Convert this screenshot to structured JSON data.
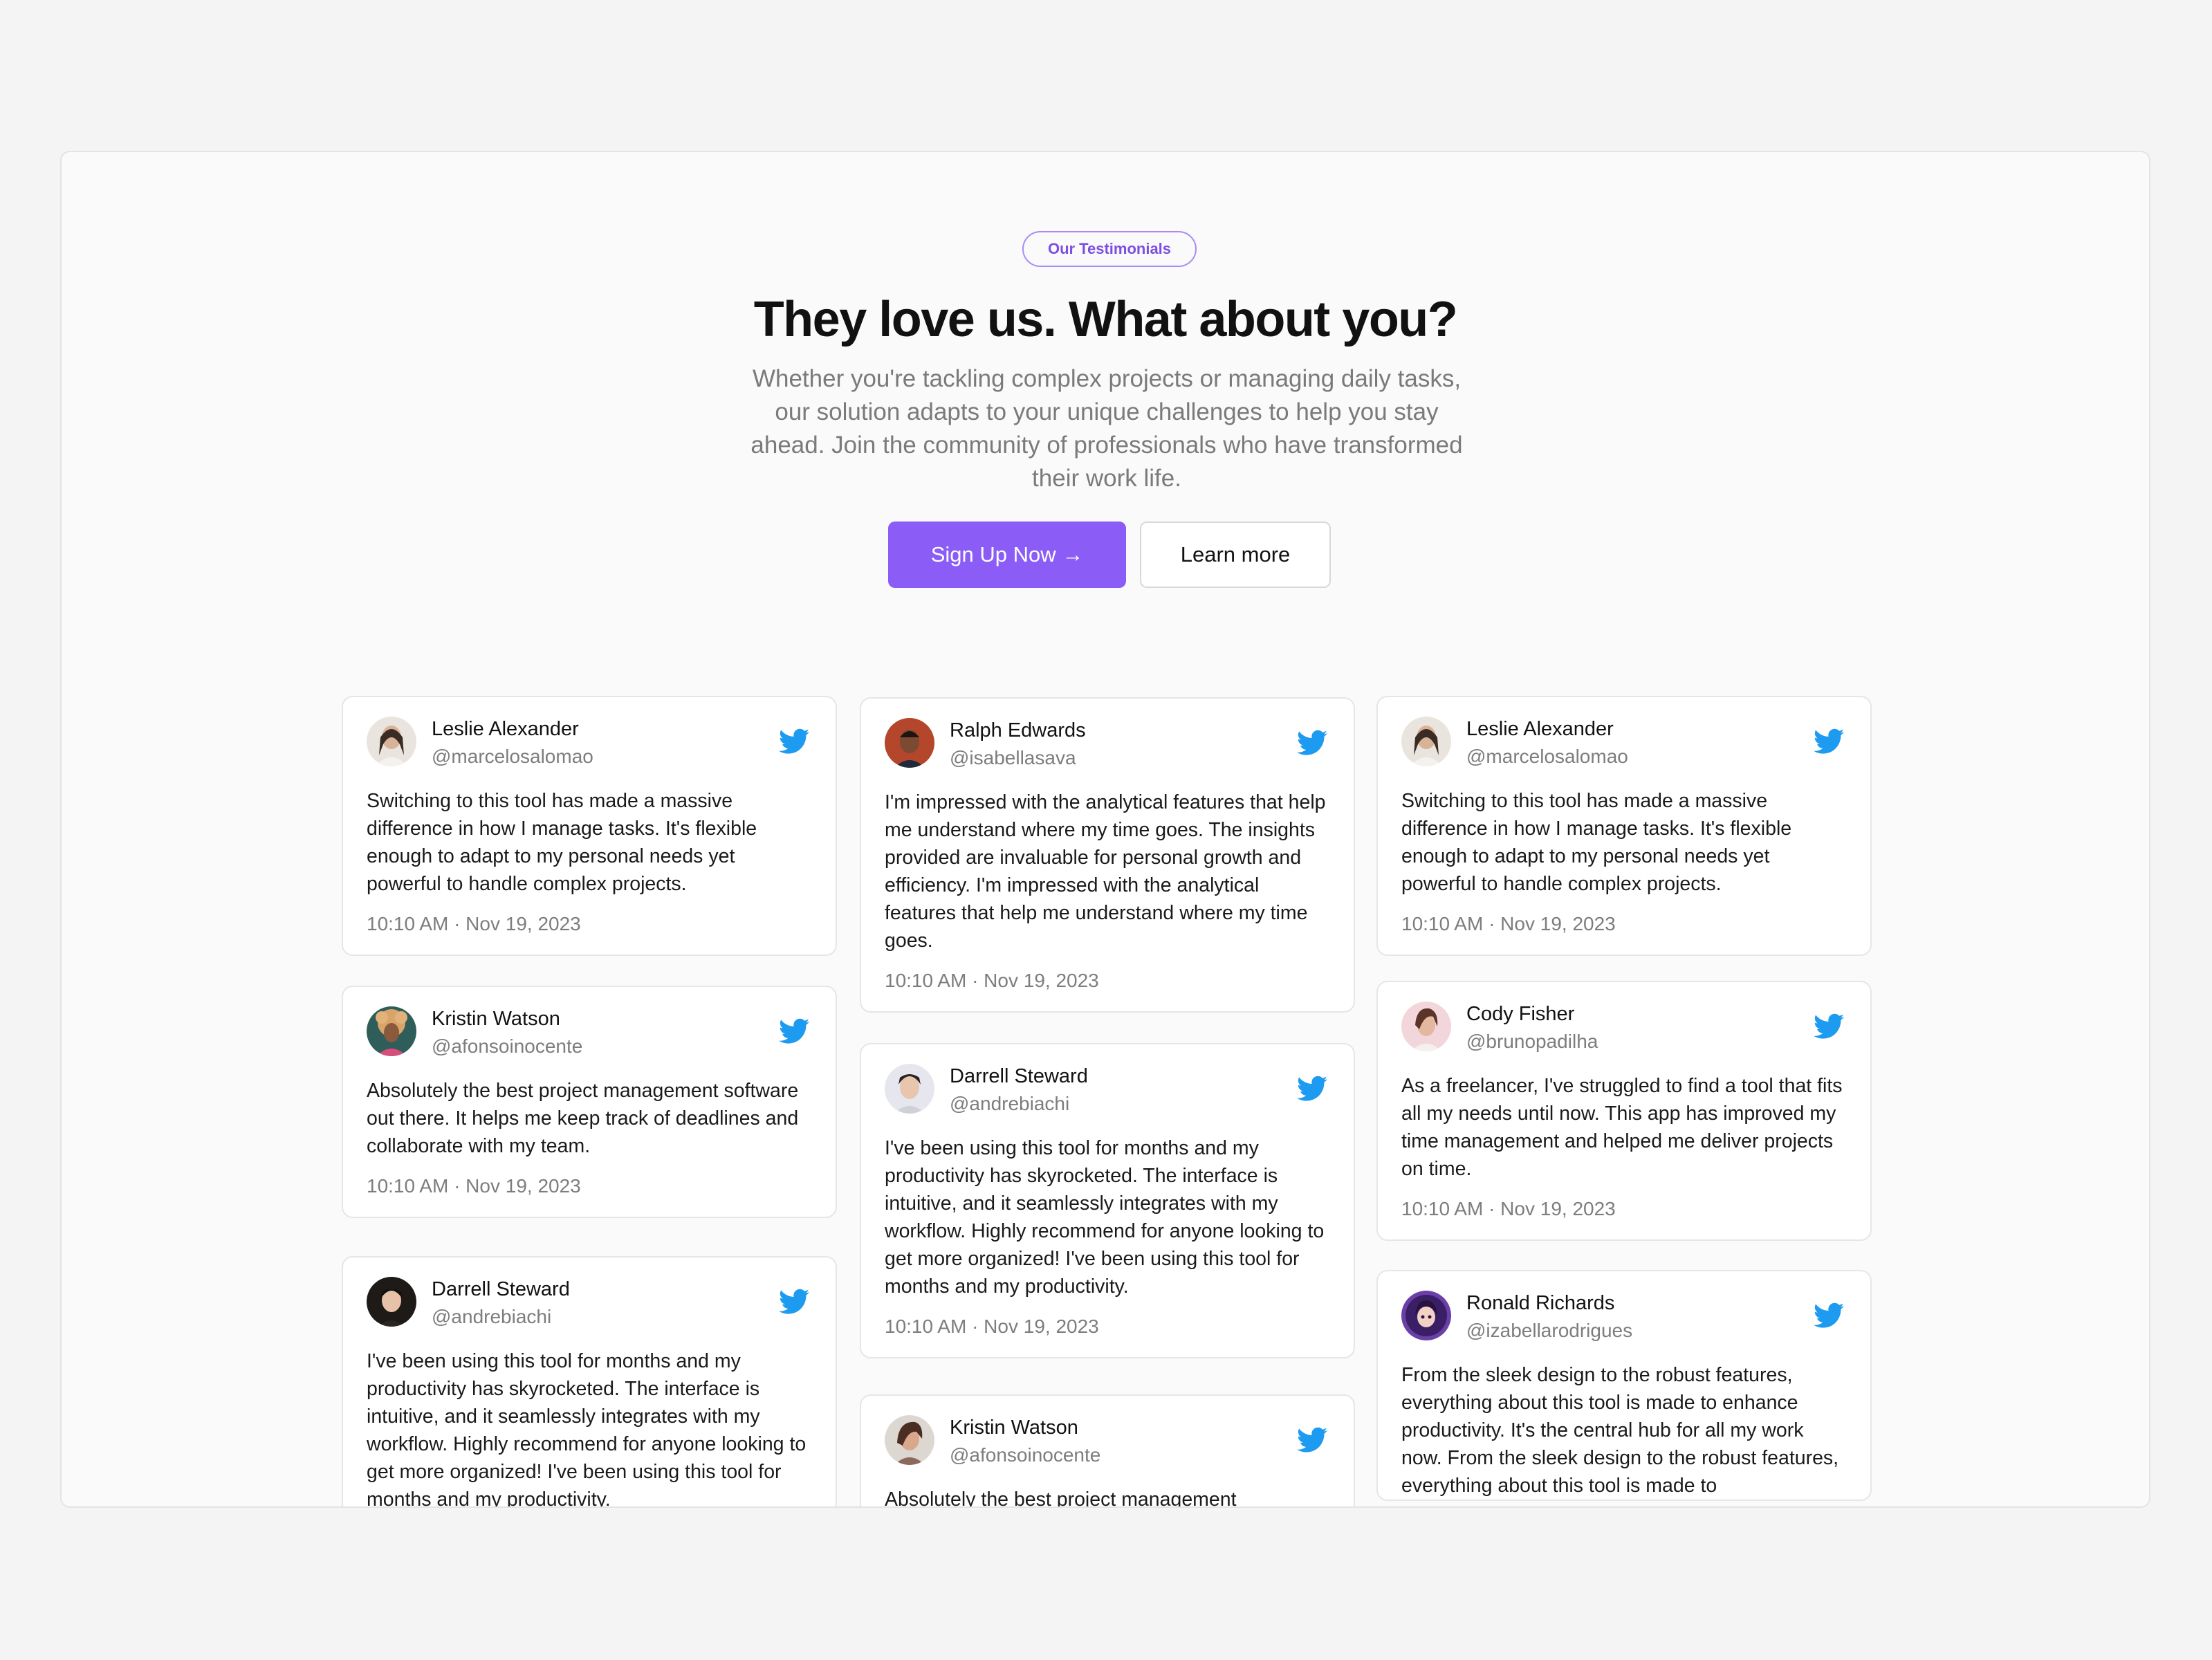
{
  "hero": {
    "badge": "Our Testimonials",
    "headline": "They love us. What about you?",
    "subtitle": "Whether you're tackling complex projects or managing daily tasks, our solution adapts to your unique challenges to help you stay ahead. Join the community of professionals who have transformed their work life.",
    "primary_button": "Sign Up Now →",
    "secondary_button": "Learn more"
  },
  "colors": {
    "accent": "#8b5cf6",
    "twitter": "#1d9bf0",
    "heading": "#111111",
    "muted": "#7a7a7a"
  },
  "columns": [
    [
      {
        "name": "Leslie Alexander",
        "handle": "@marcelosalomao",
        "text": "Switching to this tool has made a massive difference in how I manage tasks. It's flexible enough to adapt to my personal needs yet powerful to handle complex projects.",
        "time": "10:10 AM · Nov 19, 2023",
        "icon": "twitter-icon"
      },
      {
        "name": "Kristin Watson",
        "handle": "@afonsoinocente",
        "text": "Absolutely the best project management software out there. It helps me keep track of deadlines and collaborate with my team.",
        "time": "10:10 AM · Nov 19, 2023",
        "icon": "twitter-icon"
      },
      {
        "name": "Darrell Steward",
        "handle": "@andrebiachi",
        "text": "I've been using this tool for months and my productivity has skyrocketed. The interface is intuitive, and it seamlessly integrates with my workflow. Highly recommend for anyone looking to get more organized! I've been using this tool for months and my productivity.",
        "time": "",
        "icon": "twitter-icon"
      }
    ],
    [
      {
        "name": "Ralph Edwards",
        "handle": "@isabellasava",
        "text": "I'm impressed with the analytical features that help me understand where my time goes. The insights provided are invaluable for personal growth and efficiency. I'm impressed with the analytical features that help me understand where my time goes.",
        "time": "10:10 AM · Nov 19, 2023",
        "icon": "twitter-icon"
      },
      {
        "name": "Darrell Steward",
        "handle": "@andrebiachi",
        "text": "I've been using this tool for months and my productivity has skyrocketed. The interface is intuitive, and it seamlessly integrates with my workflow. Highly recommend for anyone looking to get more organized! I've been using this tool for months and my productivity.",
        "time": "10:10 AM · Nov 19, 2023",
        "icon": "twitter-icon"
      },
      {
        "name": "Kristin Watson",
        "handle": "@afonsoinocente",
        "text": "Absolutely the best project management",
        "time": "",
        "icon": "twitter-icon"
      }
    ],
    [
      {
        "name": "Leslie Alexander",
        "handle": "@marcelosalomao",
        "text": "Switching to this tool has made a massive difference in how I manage tasks. It's flexible enough to adapt to my personal needs yet powerful to handle complex projects.",
        "time": "10:10 AM · Nov 19, 2023",
        "icon": "twitter-icon"
      },
      {
        "name": "Cody Fisher",
        "handle": "@brunopadilha",
        "text": "As a freelancer, I've struggled to find a tool that fits all my needs until now. This app has improved my time management and helped me deliver projects on time.",
        "time": "10:10 AM · Nov 19, 2023",
        "icon": "twitter-icon"
      },
      {
        "name": "Ronald Richards",
        "handle": "@izabellarodrigues",
        "text": "From the sleek design to the robust features, everything about this tool is made to enhance productivity. It's the central hub for all my work now. From the sleek design to the robust features, everything about this tool is made to",
        "time": "",
        "icon": "twitter-icon"
      }
    ]
  ]
}
